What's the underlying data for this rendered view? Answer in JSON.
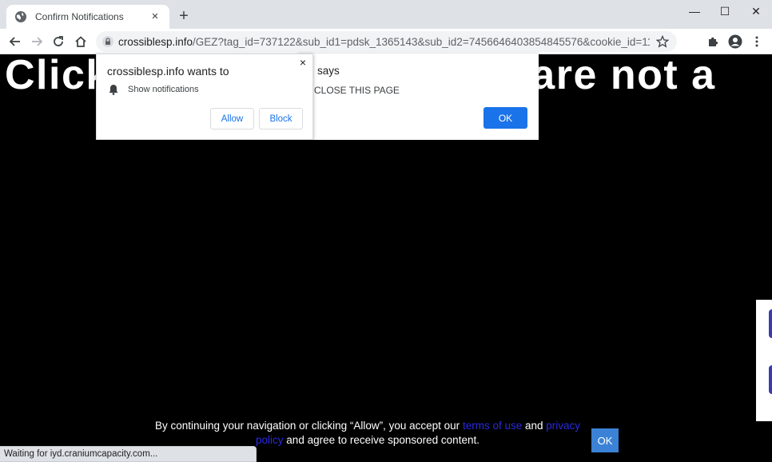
{
  "tab": {
    "title": "Confirm Notifications",
    "close": "×"
  },
  "new_tab": "+",
  "window_controls": {
    "minimize": "—",
    "maximize": "☐",
    "close": "✕"
  },
  "omnibox": {
    "host": "crossiblesp.info",
    "path": "/GEZ?tag_id=737122&sub_id1=pdsk_1365143&sub_id2=7456646403854845576&cookie_id=111bd9a9-cf06-..."
  },
  "page": {
    "headline": "Click                          you are not a",
    "consent": {
      "pre": "By continuing your navigation or clicking “Allow”, you accept our ",
      "terms": "terms of use",
      "mid": " and ",
      "privacy": "privacy policy",
      "post": " and agree to receive sponsored content."
    },
    "consent_ok": "OK",
    "status": "Waiting for iyd.craniumcapacity.com..."
  },
  "alert": {
    "title": "says",
    "message": "CLOSE THIS PAGE",
    "ok": "OK"
  },
  "permission": {
    "title": "crossiblesp.info wants to",
    "close": "×",
    "item": "Show notifications",
    "allow": "Allow",
    "block": "Block"
  },
  "colors": {
    "accent": "#1a73e8",
    "link": "#2a2ae0"
  }
}
